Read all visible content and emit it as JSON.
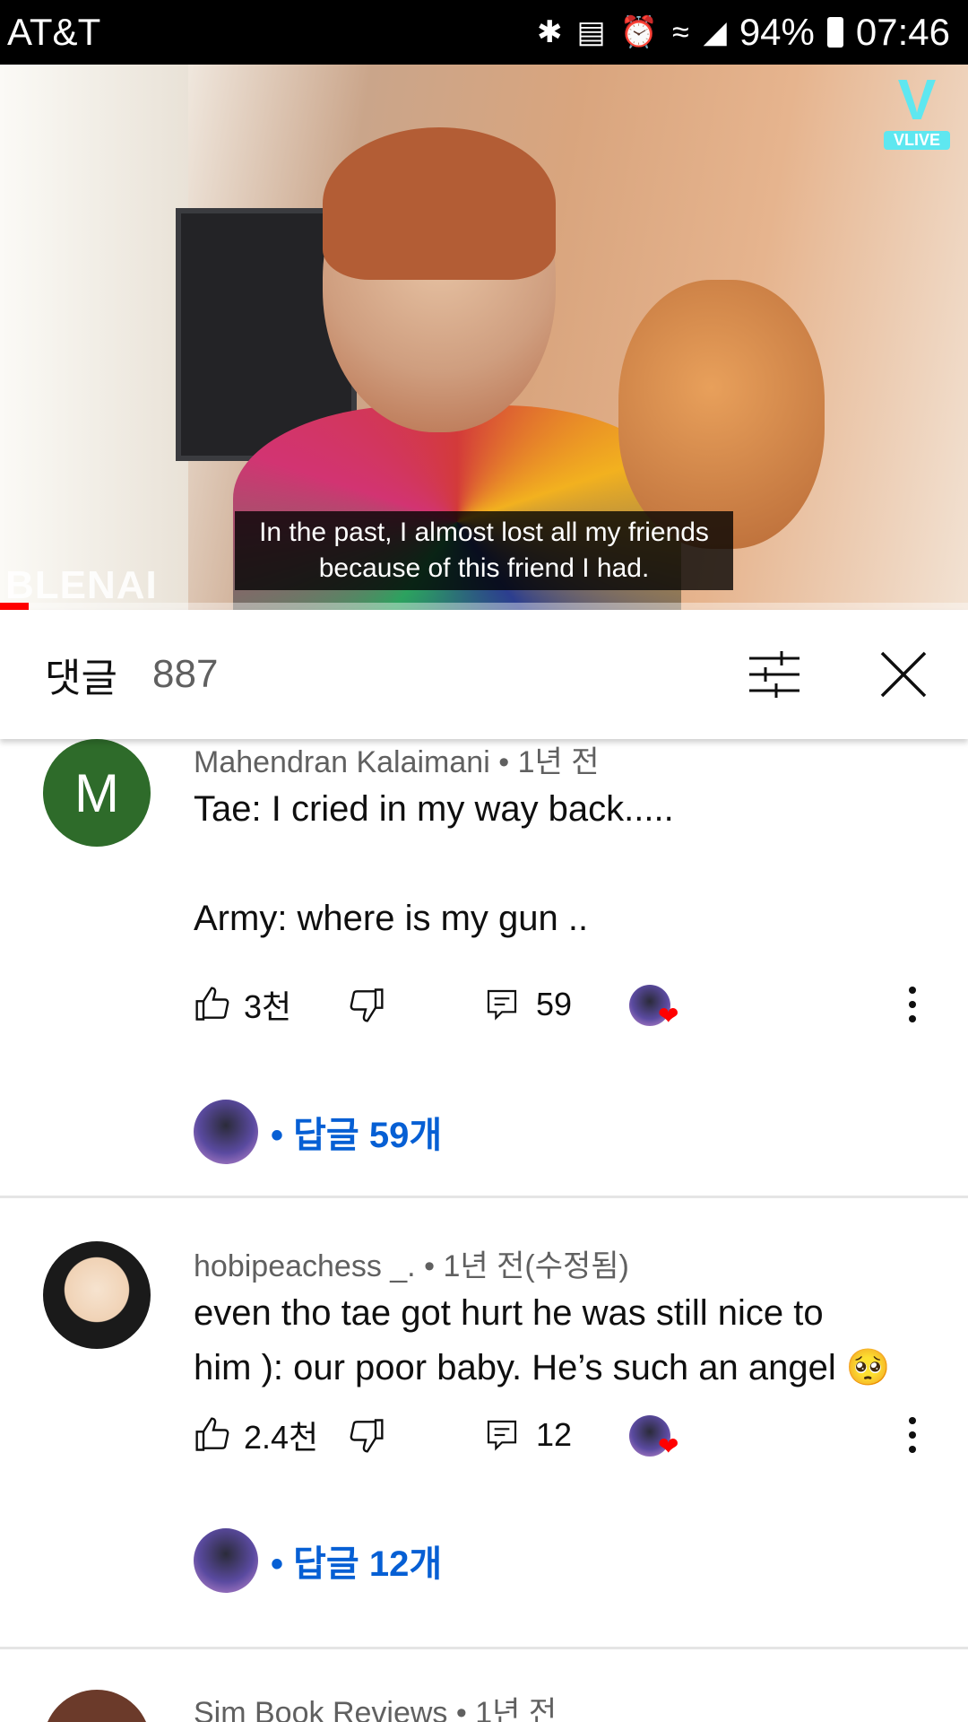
{
  "status_bar": {
    "carrier": "AT&T",
    "battery": "94%",
    "time": "07:46",
    "icons": [
      "bluetooth-icon",
      "vibrate-icon",
      "alarm-icon",
      "wifi-icon",
      "signal-icon",
      "battery-icon"
    ]
  },
  "video": {
    "subtitle_line1": "In the past, I almost lost all my friends",
    "subtitle_line2": "because of this friend I had.",
    "watermark": "BLENAI",
    "channel_logo_text": "VLIVE",
    "progress_fraction": 0.03
  },
  "comments_header": {
    "title": "댓글",
    "count": "887"
  },
  "comments": [
    {
      "author": "Mahendran Kalaimani",
      "time": "1년 전",
      "avatar_letter": "M",
      "text_line1": "Tae: I cried in my way back.....",
      "text_line2": "Army: where is my gun ..",
      "likes": "3천",
      "reply_count": "59",
      "replies_link": "답글 59개"
    },
    {
      "author": "hobipeachess _.",
      "time": "1년 전(수정됨)",
      "text_line1": "even tho tae got hurt he was still nice to",
      "text_line2": "him ): our poor baby. He’s such an angel 🥺",
      "likes": "2.4천",
      "reply_count": "12",
      "replies_link": "답글 12개"
    },
    {
      "author": "Sim Book Reviews",
      "time": "1년 전"
    }
  ],
  "colors": {
    "link_blue": "#065fd4",
    "avatar_green": "#2e6b2a",
    "heart_red": "#ff0000"
  }
}
